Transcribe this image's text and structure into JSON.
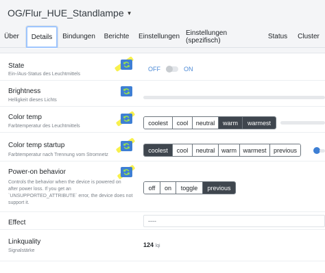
{
  "device": {
    "title": "OG/Flur_HUE_Standlampe"
  },
  "tabs": [
    {
      "label": "Über"
    },
    {
      "label": "Details"
    },
    {
      "label": "Bindungen"
    },
    {
      "label": "Berichte"
    },
    {
      "label": "Einstellungen"
    },
    {
      "label": "Einstellungen (spezifisch)"
    },
    {
      "label": "Status"
    },
    {
      "label": "Cluster"
    }
  ],
  "active_tab": "Details",
  "rows": {
    "state": {
      "title": "State",
      "desc": "Ein-/Aus-Status des Leuchtmittels",
      "off": "OFF",
      "on": "ON"
    },
    "brightness": {
      "title": "Brightness",
      "desc": "Helligkeit dieses Lichts"
    },
    "color_temp": {
      "title": "Color temp",
      "desc": "Farbtemperatur des Leuchtmittels",
      "options": [
        "coolest",
        "cool",
        "neutral",
        "warm",
        "warmest"
      ],
      "selected": [
        "warm",
        "warmest"
      ]
    },
    "color_temp_startup": {
      "title": "Color temp startup",
      "desc": "Farbtemperatur nach Trennung vom Stromnetz",
      "options": [
        "coolest",
        "cool",
        "neutral",
        "warm",
        "warmest",
        "previous"
      ],
      "selected": [
        "coolest"
      ]
    },
    "power_on": {
      "title": "Power-on behavior",
      "desc": [
        "Controls the behavior when the device is powered on",
        "after power loss. If you get an",
        "`UNSUPPORTED_ATTRIBUTE` error, the device does not",
        "support it."
      ],
      "options": [
        "off",
        "on",
        "toggle",
        "previous"
      ],
      "selected": [
        "previous"
      ]
    },
    "effect": {
      "title": "Effect",
      "value": "----"
    },
    "linkquality": {
      "title": "Linkquality",
      "desc": "Signalstärke",
      "value": "124",
      "unit": "lqi"
    }
  },
  "colors": {
    "accent": "#3e7fd4",
    "selected_button": "#3f464e",
    "highlight": "#f6ee3c"
  },
  "icons": {
    "refresh": "refresh-icon",
    "dropdown": "chevron-down-icon"
  }
}
